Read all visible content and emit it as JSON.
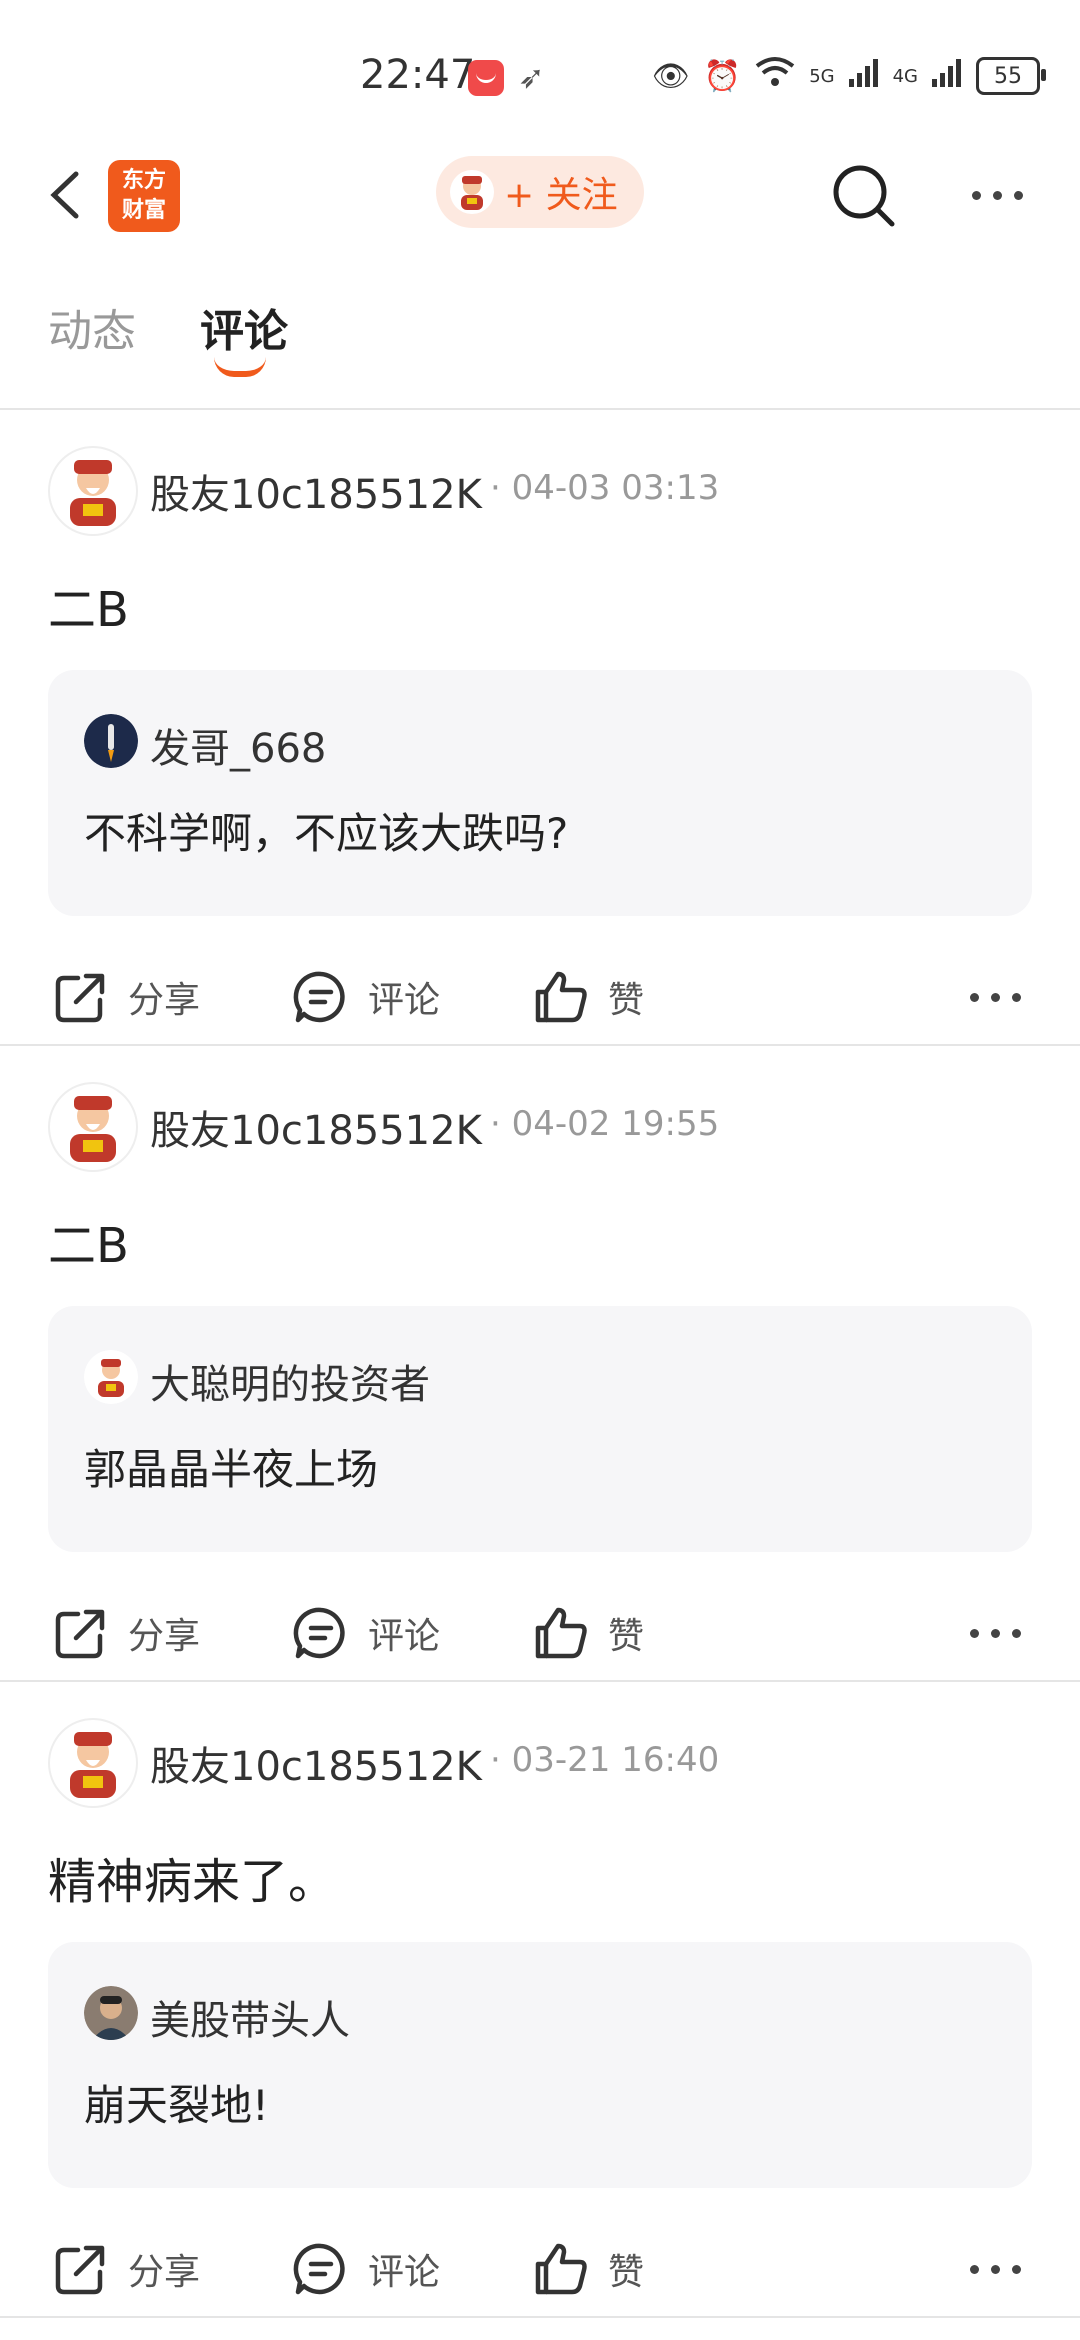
{
  "status_bar": {
    "time": "22:47",
    "network_5g": "5G",
    "network_4g": "4G",
    "battery": "55"
  },
  "header": {
    "logo_line1": "东方",
    "logo_line2": "财富",
    "follow_label": "+ 关注"
  },
  "tabs": [
    {
      "label": "动态"
    },
    {
      "label": "评论"
    }
  ],
  "actions": {
    "share": "分享",
    "comment": "评论",
    "like": "赞"
  },
  "posts": [
    {
      "user": "股友10c185512K",
      "time": "04-03 03:13",
      "content": "二B",
      "quote": {
        "user": "发哥_668",
        "text": "不科学啊，不应该大跌吗?"
      }
    },
    {
      "user": "股友10c185512K",
      "time": "04-02 19:55",
      "content": "二B",
      "quote": {
        "user": "大聪明的投资者",
        "text": "郭晶晶半夜上场"
      }
    },
    {
      "user": "股友10c185512K",
      "time": "03-21 16:40",
      "content": "精神病来了。",
      "quote": {
        "user": "美股带头人",
        "text": "崩天裂地!"
      }
    }
  ]
}
